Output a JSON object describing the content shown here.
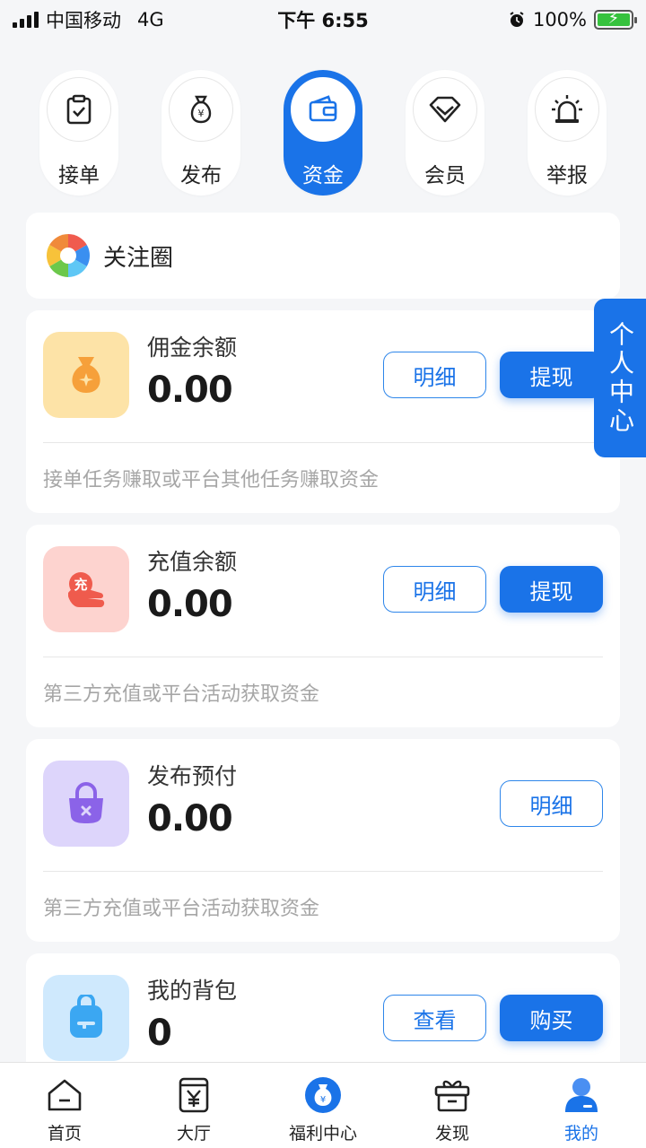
{
  "status_bar": {
    "carrier": "中国移动",
    "network": "4G",
    "time": "下午 6:55",
    "battery": "100%"
  },
  "quick_nav": [
    {
      "label": "接单",
      "icon": "clipboard-check-icon"
    },
    {
      "label": "发布",
      "icon": "money-bag-icon"
    },
    {
      "label": "资金",
      "icon": "wallet-icon",
      "active": true
    },
    {
      "label": "会员",
      "icon": "diamond-icon"
    },
    {
      "label": "举报",
      "icon": "alarm-siren-icon"
    }
  ],
  "follow": {
    "label": "关注圈",
    "icon": "camera-aperture-icon"
  },
  "side_tab": {
    "label": "个人中心"
  },
  "funds": [
    {
      "title": "佣金余额",
      "value": "0.00",
      "icon": "money-bag-icon",
      "icon_bg": "#fde3a7",
      "icon_color": "#f6a03a",
      "buttons": [
        "明细",
        "提现"
      ],
      "desc": "接单任务赚取或平台其他任务赚取资金"
    },
    {
      "title": "充值余额",
      "value": "0.00",
      "icon": "recharge-hand-icon",
      "icon_bg": "#fdd3cf",
      "icon_color": "#ef5b4d",
      "buttons": [
        "明细",
        "提现"
      ],
      "desc": "第三方充值或平台活动获取资金"
    },
    {
      "title": "发布预付",
      "value": "0.00",
      "icon": "lock-bag-icon",
      "icon_bg": "#ddd5fb",
      "icon_color": "#8b63e8",
      "buttons": [
        "明细"
      ],
      "desc": "第三方充值或平台活动获取资金"
    },
    {
      "title": "我的背包",
      "value": "0",
      "icon": "backpack-icon",
      "icon_bg": "#cfe9fd",
      "icon_color": "#3ba7f2",
      "buttons": [
        "查看",
        "购买"
      ],
      "desc": ""
    }
  ],
  "tabbar": [
    {
      "label": "首页",
      "icon": "home-icon"
    },
    {
      "label": "大厅",
      "icon": "yuan-hall-icon"
    },
    {
      "label": "福利中心",
      "icon": "welfare-bag-icon"
    },
    {
      "label": "发现",
      "icon": "gift-box-icon"
    },
    {
      "label": "我的",
      "icon": "user-icon",
      "active": true
    }
  ],
  "colors": {
    "accent": "#1a73e8",
    "background": "#f5f6f8"
  }
}
